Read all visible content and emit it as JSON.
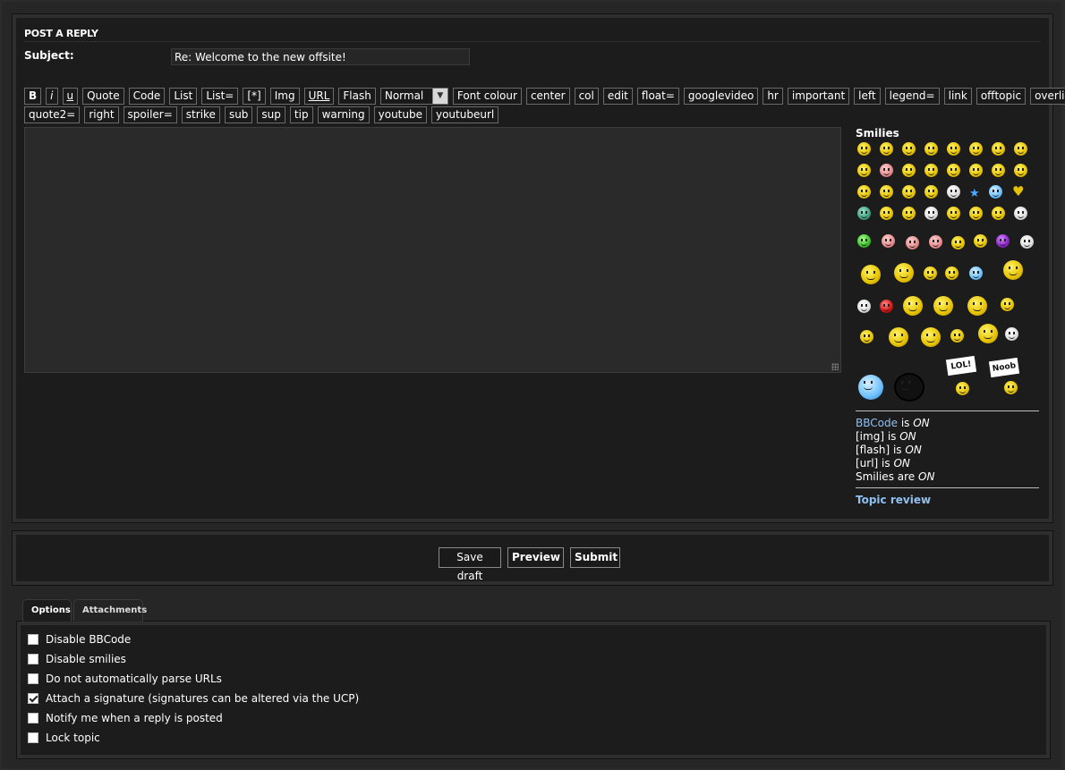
{
  "section_title": "POST A REPLY",
  "subject": {
    "label": "Subject:",
    "value": "Re: Welcome to the new offsite!"
  },
  "bbcode_buttons_row1": [
    "B",
    "i",
    "u",
    "Quote",
    "Code",
    "List",
    "List=",
    "[*]",
    "Img",
    "URL",
    "Flash"
  ],
  "font_size_select": {
    "value": "Normal"
  },
  "bbcode_buttons_row1b": [
    "Font colour",
    "center",
    "col",
    "edit",
    "float=",
    "googlevideo",
    "hr",
    "important",
    "left",
    "legend=",
    "link",
    "offtopic",
    "overline"
  ],
  "bbcode_buttons_row2": [
    "quote2=",
    "right",
    "spoiler=",
    "strike",
    "sub",
    "sup",
    "tip",
    "warning",
    "youtube",
    "youtubeurl"
  ],
  "smilies": {
    "title": "Smilies"
  },
  "status": {
    "bbcode_link": "BBCode",
    "bbcode_is": "is",
    "bbcode_state": "ON",
    "img_label": "[img] is",
    "img_state": "ON",
    "flash_label": "[flash] is",
    "flash_state": "ON",
    "url_label": "[url] is",
    "url_state": "ON",
    "smilies_label": "Smilies are",
    "smilies_state": "ON"
  },
  "topic_review": "Topic review",
  "actions": {
    "save_draft": "Save draft",
    "preview": "Preview",
    "submit": "Submit"
  },
  "tabs": {
    "options": "Options",
    "attachments": "Attachments"
  },
  "options": [
    {
      "label": "Disable BBCode",
      "checked": false
    },
    {
      "label": "Disable smilies",
      "checked": false
    },
    {
      "label": "Do not automatically parse URLs",
      "checked": false
    },
    {
      "label": "Attach a signature (signatures can be altered via the UCP)",
      "checked": true
    },
    {
      "label": "Notify me when a reply is posted",
      "checked": false
    },
    {
      "label": "Lock topic",
      "checked": false
    }
  ]
}
